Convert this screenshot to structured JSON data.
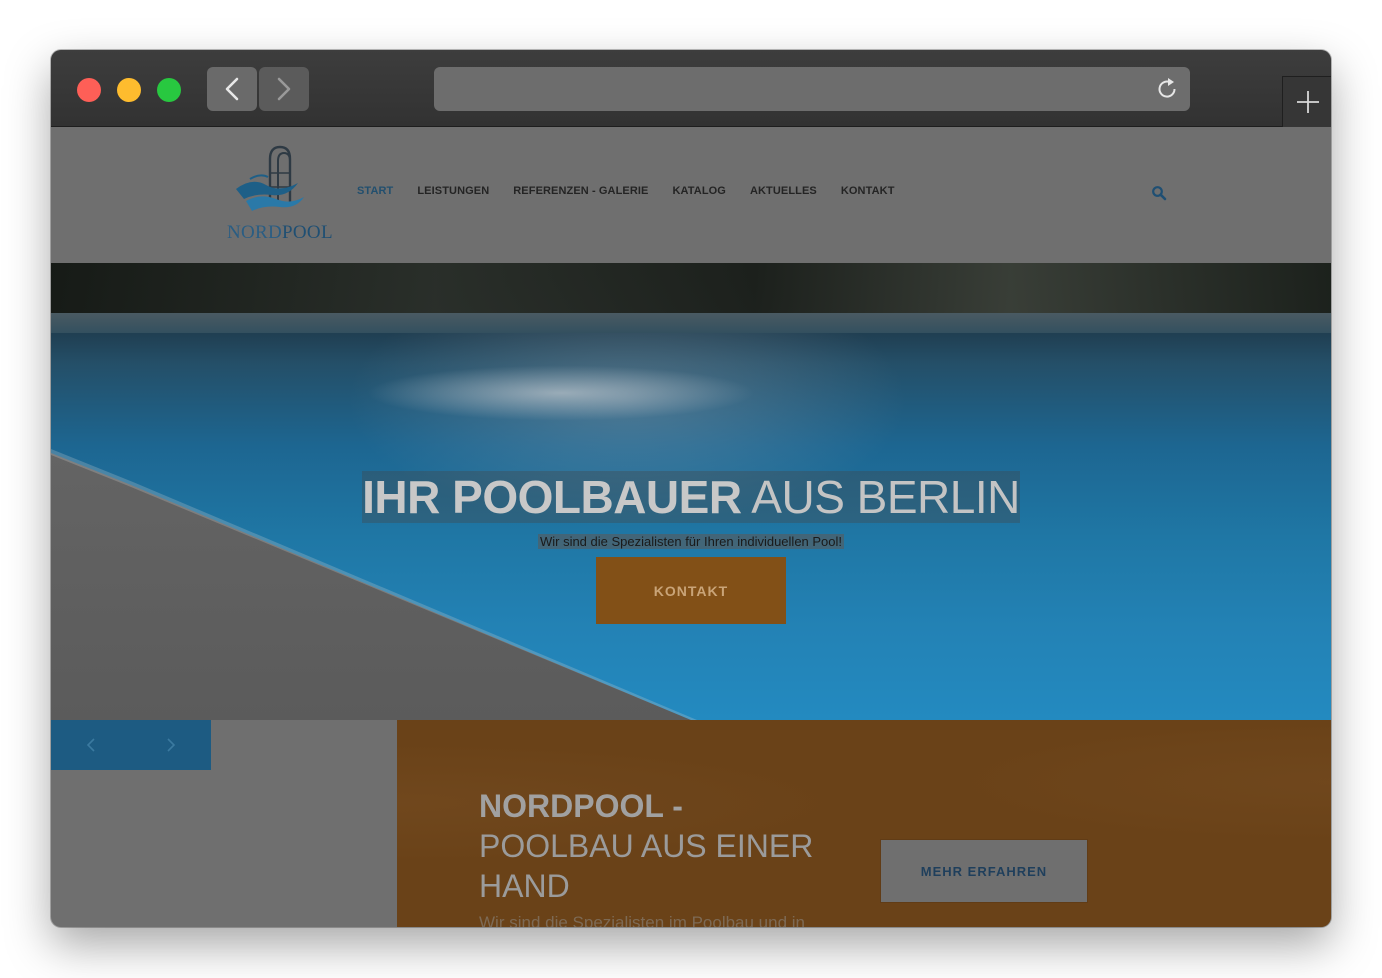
{
  "browser": {
    "url": ""
  },
  "header": {
    "logo_text_nord": "NORD",
    "logo_text_pool": "POOL",
    "nav": [
      {
        "label": "START",
        "active": true
      },
      {
        "label": "LEISTUNGEN",
        "active": false
      },
      {
        "label": "REFERENZEN - GALERIE",
        "active": false
      },
      {
        "label": "KATALOG",
        "active": false
      },
      {
        "label": "AKTUELLES",
        "active": false
      },
      {
        "label": "KONTAKT",
        "active": false
      }
    ]
  },
  "hero": {
    "title_bold": "IHR POOLBAUER",
    "title_light": " AUS BERLIN",
    "subtitle": "Wir sind die Spezialisten für Ihren individuellen Pool!",
    "cta_label": "KONTAKT"
  },
  "info_box": {
    "title_line1": "NORDPOOL -",
    "title_line2": "POOLBAU AUS EINER",
    "title_line3": "HAND",
    "text": "Wir sind die Spezialisten im Poolbau und in",
    "button_label": "MEHR ERFAHREN"
  },
  "colors": {
    "brand_blue": "#1d5b82",
    "accent_orange": "#825017"
  }
}
